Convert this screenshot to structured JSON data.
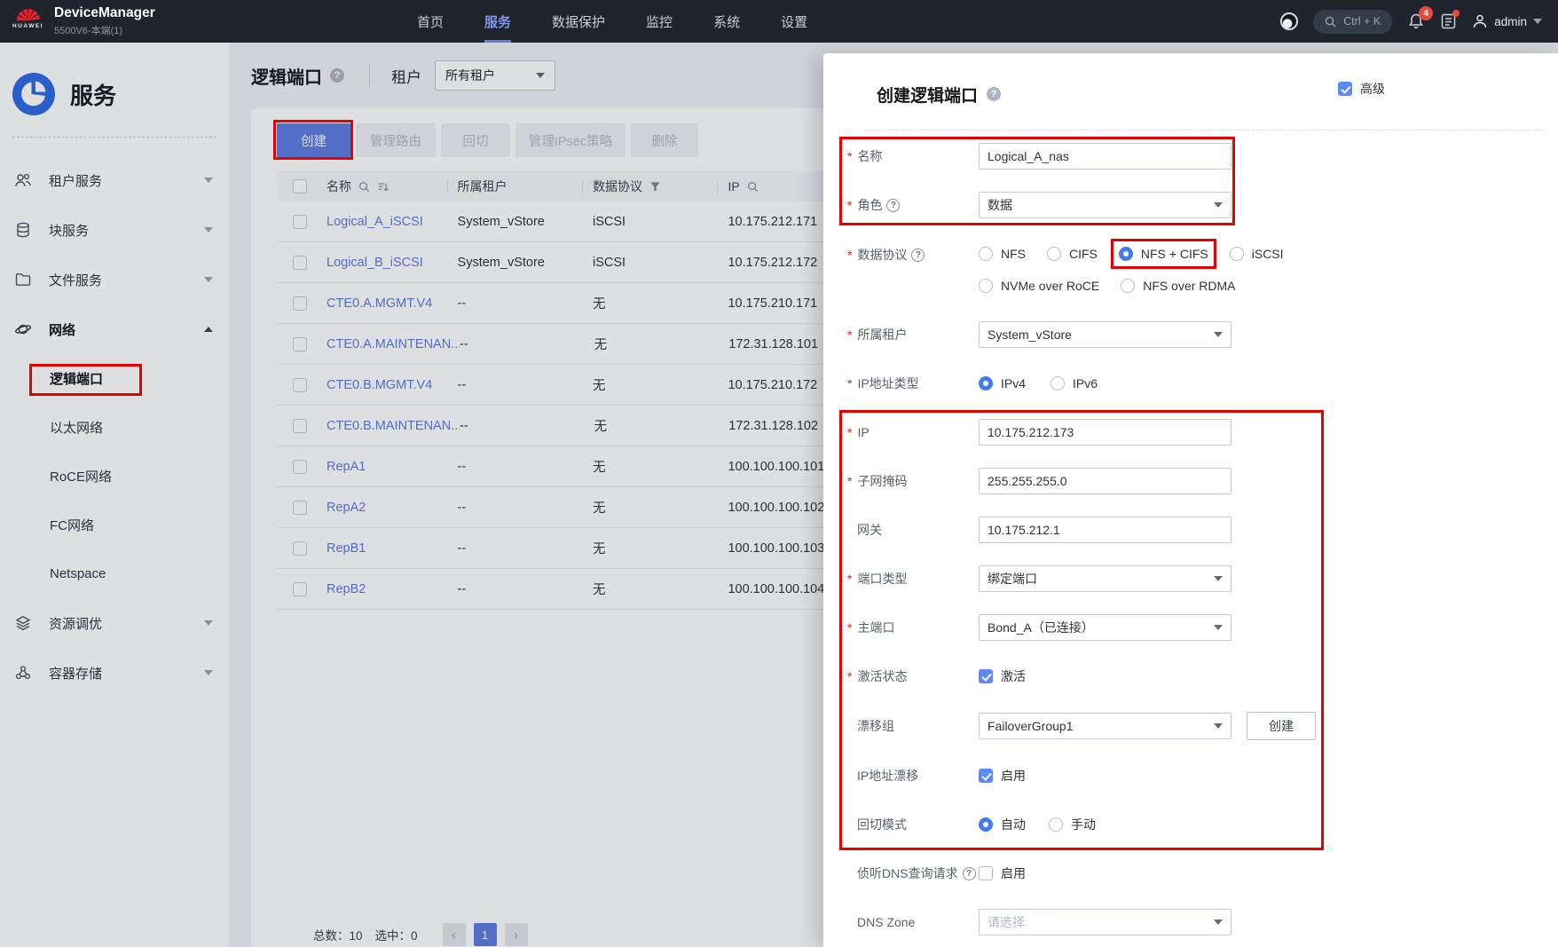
{
  "topbar": {
    "logo_text": "HUAWEI",
    "title": "DeviceManager",
    "subtitle": "5500V6-本端(1)",
    "nav": [
      {
        "label": "首页",
        "active": false
      },
      {
        "label": "服务",
        "active": true
      },
      {
        "label": "数据保护",
        "active": false
      },
      {
        "label": "监控",
        "active": false
      },
      {
        "label": "系统",
        "active": false
      },
      {
        "label": "设置",
        "active": false
      }
    ],
    "search_shortcut": "Ctrl + K",
    "alarm_badge": "4",
    "user_name": "admin"
  },
  "sidebar": {
    "title": "服务",
    "items": [
      {
        "label": "租户服务"
      },
      {
        "label": "块服务"
      },
      {
        "label": "文件服务"
      },
      {
        "label": "网络",
        "expanded": true
      },
      {
        "label": "资源调优"
      },
      {
        "label": "容器存储"
      }
    ],
    "network_children": [
      {
        "label": "逻辑端口",
        "active": true,
        "annotated": true
      },
      {
        "label": "以太网络"
      },
      {
        "label": "RoCE网络"
      },
      {
        "label": "FC网络"
      },
      {
        "label": "Netspace"
      }
    ]
  },
  "main": {
    "page_title": "逻辑端口",
    "tenant_label": "租户",
    "tenant_value": "所有租户",
    "toolbar": {
      "create": "创建",
      "manage_route": "管理路由",
      "failback": "回切",
      "manage_ipsec": "管理IPsec策略",
      "delete": "删除"
    },
    "table": {
      "col_name": "名称",
      "col_tenant": "所属租户",
      "col_protocol": "数据协议",
      "col_ip": "IP",
      "rows": [
        {
          "name": "Logical_A_iSCSI",
          "tenant": "System_vStore",
          "protocol": "iSCSI",
          "ip": "10.175.212.171"
        },
        {
          "name": "Logical_B_iSCSI",
          "tenant": "System_vStore",
          "protocol": "iSCSI",
          "ip": "10.175.212.172"
        },
        {
          "name": "CTE0.A.MGMT.V4",
          "tenant": "--",
          "protocol": "无",
          "ip": "10.175.210.171"
        },
        {
          "name": "CTE0.A.MAINTENAN...",
          "tenant": "--",
          "protocol": "无",
          "ip": "172.31.128.101"
        },
        {
          "name": "CTE0.B.MGMT.V4",
          "tenant": "--",
          "protocol": "无",
          "ip": "10.175.210.172"
        },
        {
          "name": "CTE0.B.MAINTENAN...",
          "tenant": "--",
          "protocol": "无",
          "ip": "172.31.128.102"
        },
        {
          "name": "RepA1",
          "tenant": "--",
          "protocol": "无",
          "ip": "100.100.100.101"
        },
        {
          "name": "RepA2",
          "tenant": "--",
          "protocol": "无",
          "ip": "100.100.100.102"
        },
        {
          "name": "RepB1",
          "tenant": "--",
          "protocol": "无",
          "ip": "100.100.100.103"
        },
        {
          "name": "RepB2",
          "tenant": "--",
          "protocol": "无",
          "ip": "100.100.100.104"
        }
      ],
      "total_label": "总数：10",
      "selected_label": "选中：0",
      "page": "1"
    }
  },
  "drawer": {
    "title": "创建逻辑端口",
    "advanced_label": "高级",
    "advanced_checked": true,
    "name": {
      "label": "名称",
      "value": "Logical_A_nas"
    },
    "role": {
      "label": "角色",
      "value": "数据"
    },
    "protocol": {
      "label": "数据协议",
      "options": [
        "NFS",
        "CIFS",
        "NFS + CIFS",
        "iSCSI",
        "NVMe over RoCE",
        "NFS over RDMA"
      ],
      "selected": "NFS + CIFS"
    },
    "tenant": {
      "label": "所属租户",
      "value": "System_vStore"
    },
    "ip_type": {
      "label": "IP地址类型",
      "options": [
        "IPv4",
        "IPv6"
      ],
      "selected": "IPv4"
    },
    "ip": {
      "label": "IP",
      "value": "10.175.212.173"
    },
    "subnet_mask": {
      "label": "子网掩码",
      "value": "255.255.255.0"
    },
    "gateway": {
      "label": "网关",
      "value": "10.175.212.1"
    },
    "port_type": {
      "label": "端口类型",
      "value": "绑定端口"
    },
    "home_port": {
      "label": "主端口",
      "value": "Bond_A（已连接）"
    },
    "active_state": {
      "label": "激活状态",
      "option": "激活",
      "checked": true
    },
    "failover_group": {
      "label": "漂移组",
      "value": "FailoverGroup1",
      "create_button": "创建"
    },
    "ip_failover": {
      "label": "IP地址漂移",
      "option": "启用",
      "checked": true
    },
    "failback_mode": {
      "label": "回切模式",
      "options": [
        "自动",
        "手动"
      ],
      "selected": "自动"
    },
    "dns_listen": {
      "label": "侦听DNS查询请求",
      "option": "启用",
      "checked": false
    },
    "dns_zone": {
      "label": "DNS Zone",
      "placeholder": "请选择"
    }
  },
  "colors": {
    "accent_blue": "#5e7ce0",
    "radio_blue": "#3e7cf0",
    "annotation_red": "#e60000",
    "link_blue": "#5b7be0",
    "topbar_bg": "#20242d",
    "badge_red": "#e8493a"
  }
}
